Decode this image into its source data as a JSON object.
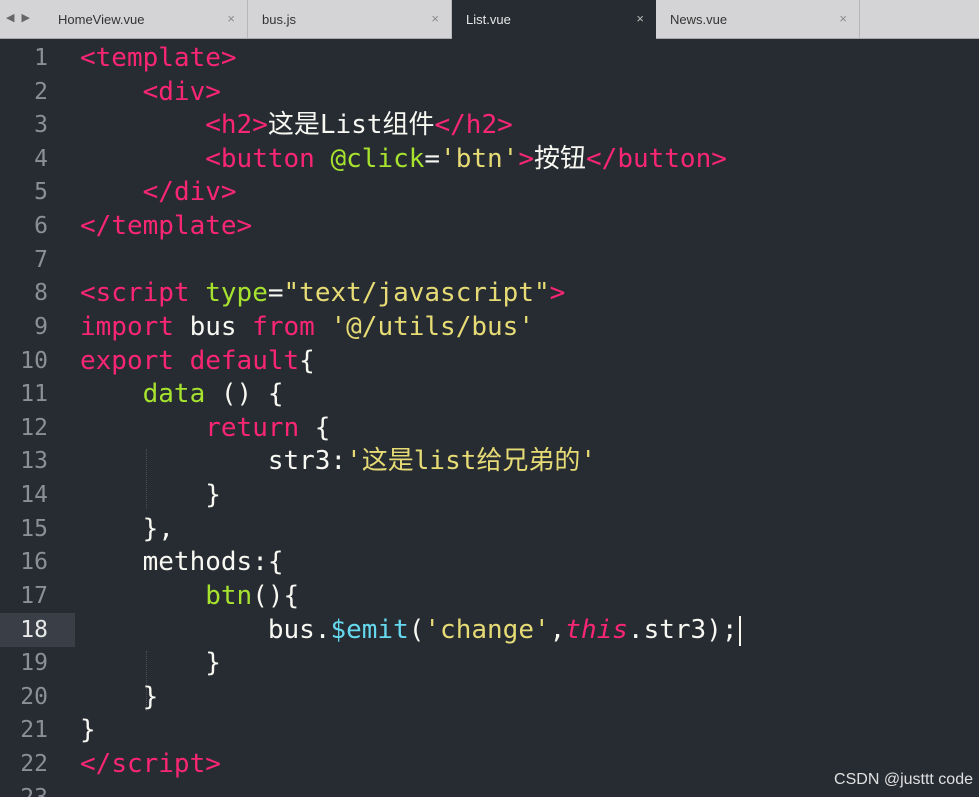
{
  "tabbar": {
    "nav_arrows": "◀ ▶",
    "tabs": [
      {
        "label": "HomeView.vue",
        "close": "×",
        "active": false
      },
      {
        "label": "bus.js",
        "close": "×",
        "active": false
      },
      {
        "label": "List.vue",
        "close": "×",
        "active": true
      },
      {
        "label": "News.vue",
        "close": "×",
        "active": false
      }
    ]
  },
  "editor": {
    "line_numbers": [
      "1",
      "2",
      "3",
      "4",
      "5",
      "6",
      "7",
      "8",
      "9",
      "10",
      "11",
      "12",
      "13",
      "14",
      "15",
      "16",
      "17",
      "18",
      "19",
      "20",
      "21",
      "22",
      "23"
    ],
    "current_line": "18",
    "code": {
      "l1": {
        "open": "<",
        "tag": "template",
        "close": ">"
      },
      "l2": {
        "open": "<",
        "tag": "div",
        "close": ">"
      },
      "l3": {
        "open": "<",
        "tag": "h2",
        "close": ">",
        "text": "这是List组件",
        "end_open": "</",
        "end_tag": "h2",
        "end_close": ">"
      },
      "l4": {
        "open": "<",
        "tag": "button",
        "attr": "@click",
        "eq": "=",
        "val": "'btn'",
        "close": ">",
        "text": "按钮",
        "end_open": "</",
        "end_tag": "button",
        "end_close": ">"
      },
      "l5": {
        "open": "</",
        "tag": "div",
        "close": ">"
      },
      "l6": {
        "open": "</",
        "tag": "template",
        "close": ">"
      },
      "l8": {
        "open": "<",
        "tag": "script",
        "attr": "type",
        "eq": "=",
        "val": "\"text/javascript\"",
        "close": ">"
      },
      "l9": {
        "kw1": "import",
        "name": "bus",
        "kw2": "from",
        "val": "'@/utils/bus'"
      },
      "l10": {
        "kw1": "export",
        "kw2": "default",
        "brace": "{"
      },
      "l11": {
        "fn": "data",
        "rest": " () {"
      },
      "l12": {
        "kw": "return",
        "rest": " {"
      },
      "l13": {
        "key": "str3:",
        "val": "'这是list给兄弟的'"
      },
      "l14": {
        "text": "}"
      },
      "l15": {
        "text": "},"
      },
      "l16": {
        "text": "methods:{"
      },
      "l17": {
        "fn": "btn",
        "rest": "(){"
      },
      "l18": {
        "obj": "bus.",
        "method": "$emit",
        "paren": "(",
        "val": "'change'",
        "comma": ",",
        "this": "this",
        "rest": ".str3);"
      },
      "l19": {
        "text": "}"
      },
      "l20": {
        "text": "}"
      },
      "l21": {
        "text": "}"
      },
      "l22": {
        "open": "</",
        "tag": "script",
        "close": ">"
      }
    }
  },
  "watermark": "CSDN @justtt code"
}
